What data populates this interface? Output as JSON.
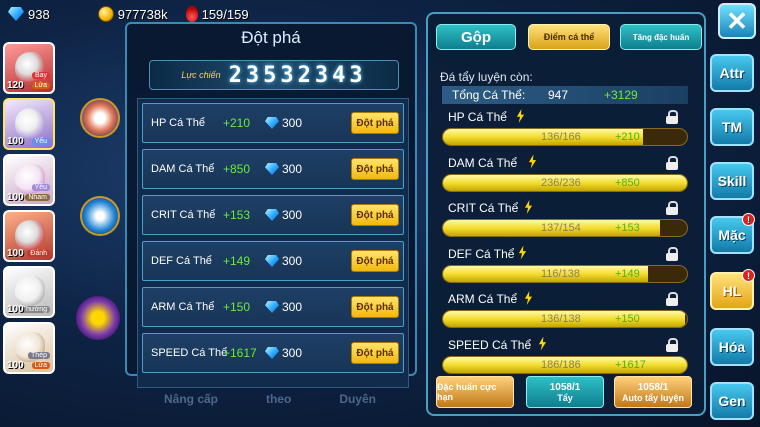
{
  "topbar": {
    "gems": "938",
    "gold": "977738k",
    "stamina": "159/159"
  },
  "pets": [
    {
      "level": "120",
      "tag1": "Bay",
      "tag2": "Lửa",
      "num": "4"
    },
    {
      "level": "100",
      "tag1": "Yếu",
      "tag2": "",
      "num": "4"
    },
    {
      "level": "100",
      "tag1": "Yếu",
      "tag2": "Nham",
      "num": "3"
    },
    {
      "level": "100",
      "tag1": "",
      "tag2": "Đánh",
      "num": "4"
    },
    {
      "level": "100",
      "tag1": "",
      "tag2": "Thường",
      "num": "2"
    },
    {
      "level": "100",
      "tag1": "Thép",
      "tag2": "Lửa",
      "num": ""
    }
  ],
  "bottom_nav": [
    "Nâng cấp",
    "theo",
    "Duyên"
  ],
  "breakthrough": {
    "title": "Đột phá",
    "power_label": "Lực chiến",
    "power_value": "23532343",
    "rows": [
      {
        "stat": "HP Cá Thể",
        "bonus": "+210",
        "cost": "300",
        "button": "Đột phá"
      },
      {
        "stat": "DAM Cá Thể",
        "bonus": "+850",
        "cost": "300",
        "button": "Đột phá"
      },
      {
        "stat": "CRIT Cá Thể",
        "bonus": "+153",
        "cost": "300",
        "button": "Đột phá"
      },
      {
        "stat": "DEF Cá Thể",
        "bonus": "+149",
        "cost": "300",
        "button": "Đột phá"
      },
      {
        "stat": "ARM Cá Thể",
        "bonus": "+150",
        "cost": "300",
        "button": "Đột phá"
      },
      {
        "stat": "SPEED Cá Thể",
        "bonus": "+1617",
        "cost": "300",
        "button": "Đột phá"
      }
    ]
  },
  "training": {
    "tabs": [
      "Gộp",
      "Điểm cá thể",
      "Tăng đặc huấn"
    ],
    "subtitle": "Đá tẩy luyện còn:",
    "total_label": "Tổng Cá Thể:",
    "total_value": "947",
    "total_bonus": "+3129",
    "stats": [
      {
        "name": "HP Cá Thể",
        "current": "136/166",
        "bonus": "+210",
        "fill": 0.82
      },
      {
        "name": "DAM Cá Thể",
        "current": "236/236",
        "bonus": "+850",
        "fill": 1.0
      },
      {
        "name": "CRIT Cá Thể",
        "current": "137/154",
        "bonus": "+153",
        "fill": 0.89
      },
      {
        "name": "DEF Cá Thể",
        "current": "116/138",
        "bonus": "+149",
        "fill": 0.84
      },
      {
        "name": "ARM Cá Thể",
        "current": "136/138",
        "bonus": "+150",
        "fill": 0.99
      },
      {
        "name": "SPEED Cá Thể",
        "current": "186/186",
        "bonus": "+1617",
        "fill": 1.0
      }
    ],
    "btn_special": "Đặc huấn cực hạn",
    "btn_wash_count": "1058/1",
    "btn_wash_label": "Tẩy",
    "btn_auto_count": "1058/1",
    "btn_auto_label": "Auto tẩy luyện"
  },
  "side_buttons": [
    "Attr",
    "TM",
    "Skill",
    "Mặc",
    "HL",
    "Hóa",
    "Gen"
  ],
  "side_badges": {
    "Mặc": "!",
    "HL": "!"
  },
  "close_label": "✕",
  "colors": {
    "bonus_green": "#6eea3b",
    "accent_gold": "#f3dd30",
    "panel_border": "#4a9ec4"
  }
}
